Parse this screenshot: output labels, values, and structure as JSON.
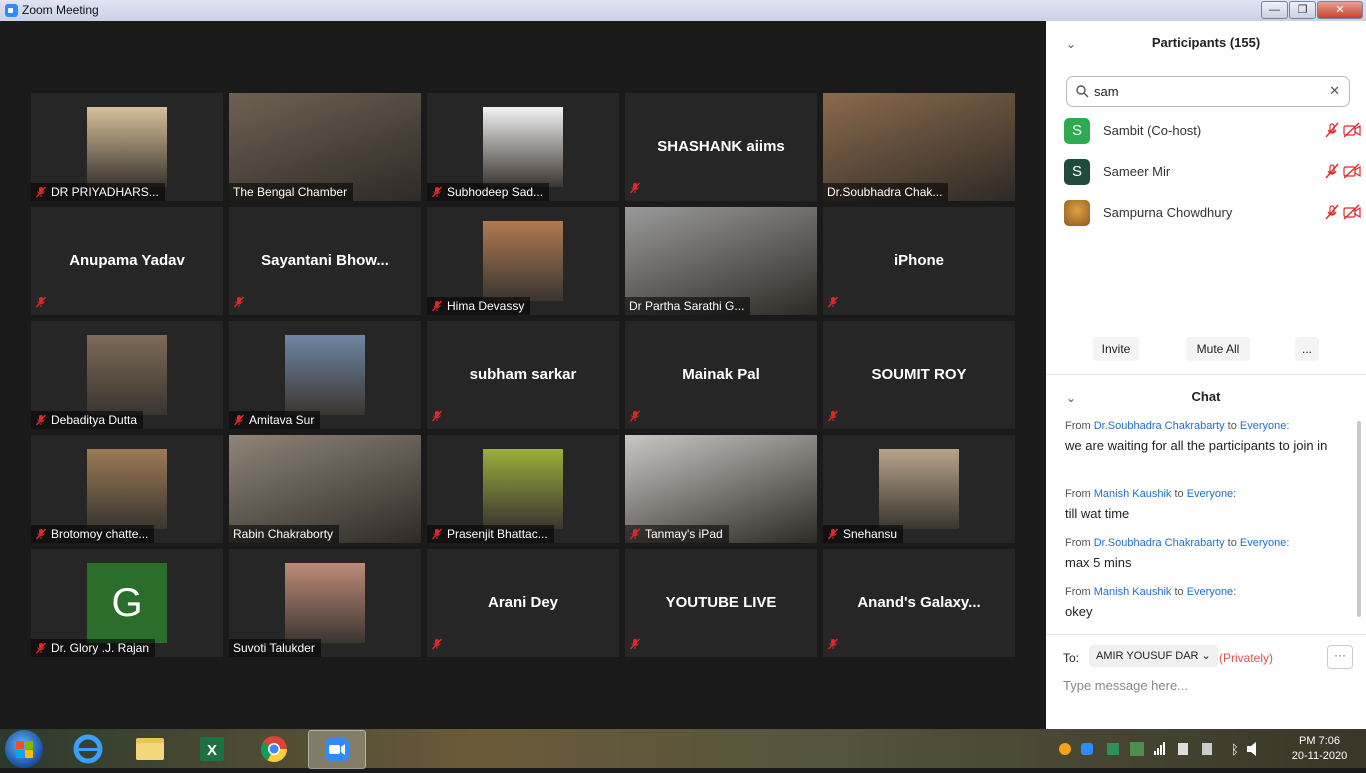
{
  "window": {
    "title": "Zoom Meeting",
    "minimize": "—",
    "maximize": "❐",
    "close": "✕"
  },
  "tiles": [
    {
      "name": "DR PRIYADHARS...",
      "muted": true,
      "kind": "photo",
      "color": "#d7c09a"
    },
    {
      "name": "The Bengal Chamber",
      "muted": false,
      "kind": "video",
      "color": "#6e6152"
    },
    {
      "name": "Subhodeep Sad...",
      "muted": true,
      "kind": "photo",
      "color": "#f2f2f2"
    },
    {
      "name": "SHASHANK aiims",
      "muted": true,
      "kind": "text",
      "big": "SHASHANK aiims"
    },
    {
      "name": "Dr.Soubhadra Chak...",
      "muted": false,
      "kind": "video",
      "color": "#8a6a4c"
    },
    {
      "name": "Anupama Yadav",
      "muted": true,
      "kind": "text",
      "big": "Anupama Yadav"
    },
    {
      "name": "Sayantani  Bhow...",
      "muted": true,
      "kind": "text",
      "big": "Sayantani  Bhow..."
    },
    {
      "name": "Hima Devassy",
      "muted": true,
      "kind": "photo",
      "color": "#b07a52"
    },
    {
      "name": "Dr Partha Sarathi G...",
      "muted": false,
      "kind": "video",
      "color": "#9a9a9a"
    },
    {
      "name": "iPhone",
      "muted": true,
      "kind": "text",
      "big": "iPhone"
    },
    {
      "name": "Debaditya Dutta",
      "muted": true,
      "kind": "photo",
      "color": "#7d6a57"
    },
    {
      "name": "Amitava Sur",
      "muted": true,
      "kind": "photo",
      "color": "#6f86a3"
    },
    {
      "name": "subham sarkar",
      "muted": true,
      "kind": "text",
      "big": "subham sarkar"
    },
    {
      "name": "Mainak Pal",
      "muted": true,
      "kind": "text",
      "big": "Mainak Pal"
    },
    {
      "name": "SOUMIT ROY",
      "muted": true,
      "kind": "text",
      "big": "SOUMIT ROY"
    },
    {
      "name": "Brotomoy chatte...",
      "muted": true,
      "kind": "photo",
      "color": "#9c7a55"
    },
    {
      "name": "Rabin Chakraborty",
      "muted": false,
      "kind": "video",
      "color": "#8e8577",
      "active": true
    },
    {
      "name": "Prasenjit Bhattac...",
      "muted": true,
      "kind": "photo",
      "color": "#9cae3a"
    },
    {
      "name": "Tanmay's iPad",
      "muted": true,
      "kind": "video",
      "color": "#c9c7c4"
    },
    {
      "name": "Snehansu",
      "muted": true,
      "kind": "photo",
      "color": "#b9a48a"
    },
    {
      "name": "Dr. Glory .J. Rajan",
      "muted": true,
      "kind": "letter",
      "color": "#2b6e2c",
      "letter": "G"
    },
    {
      "name": "Suvoti Talukder",
      "muted": false,
      "kind": "photo",
      "color": "#c08a78"
    },
    {
      "name": "Arani Dey",
      "muted": true,
      "kind": "text",
      "big": "Arani Dey"
    },
    {
      "name": "YOUTUBE LIVE",
      "muted": true,
      "kind": "text",
      "big": "YOUTUBE LIVE"
    },
    {
      "name": "Anand's  Galaxy...",
      "muted": true,
      "kind": "text",
      "big": "Anand's  Galaxy..."
    }
  ],
  "participants": {
    "header": "Participants (155)",
    "search_value": "sam",
    "list": [
      {
        "initial": "S",
        "name": "Sambit (Co-host)",
        "color": "#2eaa4f"
      },
      {
        "initial": "S",
        "name": "Sameer Mir",
        "color": "#1f4a3c"
      },
      {
        "initial": "",
        "name": "Sampurna Chowdhury",
        "color": "#8a5a22"
      }
    ],
    "invite": "Invite",
    "mute_all": "Mute All",
    "more": "..."
  },
  "chat": {
    "header": "Chat",
    "messages": [
      {
        "from_label": "From",
        "sender": "Dr.Soubhadra Chakrabarty",
        "to_label": "to",
        "target": "Everyone:",
        "text": "we are waiting for all the participants to join in"
      },
      {
        "from_label": "From",
        "sender": "Manish Kaushik",
        "to_label": "to",
        "target": "Everyone:",
        "text": "till wat time"
      },
      {
        "from_label": "From",
        "sender": "Dr.Soubhadra Chakrabarty",
        "to_label": "to",
        "target": "Everyone:",
        "text": "max 5 mins"
      },
      {
        "from_label": "From",
        "sender": "Manish Kaushik",
        "to_label": "to",
        "target": "Everyone:",
        "text": "okey"
      }
    ],
    "to_label": "To:",
    "recipient": "AMIR YOUSUF DAR",
    "privately": "(Privately)",
    "more": "···",
    "placeholder": "Type message here..."
  },
  "taskbar": {
    "time": "PM 7:06",
    "date": "20-11-2020",
    "apps": [
      "internet-explorer",
      "file-explorer",
      "excel",
      "chrome",
      "zoom"
    ]
  }
}
